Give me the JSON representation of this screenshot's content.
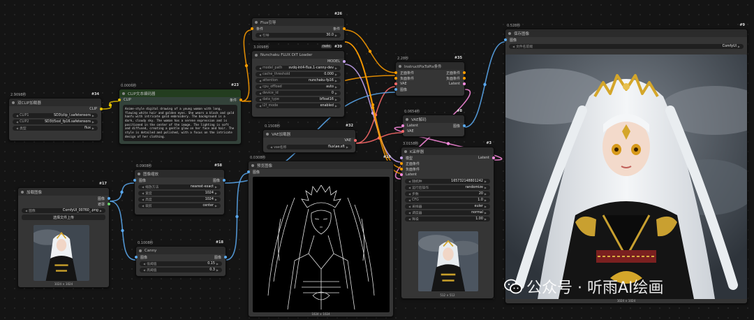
{
  "colors": {
    "clip": "#e6c200",
    "conditioning": "#ff9d00",
    "model": "#c9a7f7",
    "vae": "#ff6b6b",
    "image": "#5aa9f0",
    "latent": "#ff8ce0",
    "mask": "#6ad46a"
  },
  "nodes": {
    "dualclip": {
      "id": "#34",
      "time": "2.9098秒",
      "title": "双CLIP加载器",
      "out": "CLIP",
      "widgets": [
        {
          "label": "CLIP1",
          "value": "SD3\\clip_l.safetensors"
        },
        {
          "label": "CLIP2",
          "value": "SD3\\t5xxl_fp16.safetensors"
        },
        {
          "label": "类型",
          "value": "flux"
        }
      ]
    },
    "clipenc": {
      "id": "#23",
      "time": "0.0006秒",
      "title": "CLIP文本编码器",
      "in": "CLIP",
      "out": "条件",
      "text": "Anime-style digital drawing of a young woman with long, flowing white hair and golden eyes. She wears a black and gold hanfu with intricate gold embroidery. The background is a dark, cloudy sky. The woman has a serene expression and is positioned in the center of the image. The lighting is soft and diffused, creating a gentle glow on her face and hair. The style is detailed and polished, with a focus on the intricate design of her clothing."
    },
    "fluxguide": {
      "id": "#26",
      "title": "Flux引导",
      "in": "条件",
      "out": "条件",
      "widgets": [
        {
          "label": "引导",
          "value": "30.0"
        }
      ]
    },
    "nunchaku": {
      "id": "#39",
      "time": "3.0098秒",
      "title": "Nunchaku FLUX DiT Loader",
      "badge": "nunc",
      "out": "MODEL",
      "widgets": [
        {
          "label": "model_path",
          "value": "svdq-int4-flux.1-canny-dev"
        },
        {
          "label": "cache_threshold",
          "value": "0.000"
        },
        {
          "label": "attention",
          "value": "nunchaku-fp16"
        },
        {
          "label": "cpu_offload",
          "value": "auto"
        },
        {
          "label": "device_id",
          "value": "0"
        },
        {
          "label": "data_type",
          "value": "bfloat16"
        },
        {
          "label": "i2f_mode",
          "value": "enabled"
        }
      ]
    },
    "instruct": {
      "id": "#35",
      "time": "2.28秒",
      "title": "InstructPixToPix条件",
      "inputs": [
        "正面条件",
        "负面条件",
        "VAE",
        "图像"
      ],
      "outputs": [
        "正面条件",
        "负面条件",
        "Latent"
      ]
    },
    "vaeload": {
      "id": "#32",
      "time": "0.1508秒",
      "title": "VAE加载器",
      "out": "VAE",
      "widgets": [
        {
          "label": "vae名称",
          "value": "flux\\ae.sft"
        }
      ]
    },
    "vaedec": {
      "id": "#8",
      "time": "0.0654秒",
      "title": "VAE解码",
      "inputs": [
        "Latent",
        "VAE"
      ],
      "out": "图像"
    },
    "ksampler": {
      "id": "#3",
      "time": "3.0158秒",
      "title": "K采样器",
      "out": "Latent",
      "inputs": [
        "模型",
        "正面条件",
        "负面条件",
        "Latent"
      ],
      "widgets": [
        {
          "label": "随机种",
          "value": "165732148801242"
        },
        {
          "label": "运行后操作",
          "value": "randomize"
        },
        {
          "label": "步数",
          "value": "20"
        },
        {
          "label": "CFG",
          "value": "1.0"
        },
        {
          "label": "采样器",
          "value": "euler"
        },
        {
          "label": "调度器",
          "value": "normal"
        },
        {
          "label": "降噪",
          "value": "1.00"
        }
      ],
      "caption": "512 × 512"
    },
    "scale": {
      "id": "#58",
      "time": "0.0908秒",
      "title": "图像缩放",
      "in": "图像",
      "out": "图像",
      "widgets": [
        {
          "label": "缩放方法",
          "value": "nearest-exact"
        },
        {
          "label": "宽度",
          "value": "1024"
        },
        {
          "label": "高度",
          "value": "1024"
        },
        {
          "label": "裁剪",
          "value": "center"
        }
      ]
    },
    "loadimg": {
      "id": "#17",
      "title": "加载图像",
      "outputs": [
        "图像",
        "遮罩"
      ],
      "widgets": [
        {
          "label": "图像",
          "value": "ComfyUI_00760_.png"
        }
      ],
      "button": "选择文件上传",
      "caption": "1024 × 1024"
    },
    "canny": {
      "id": "#18",
      "time": "0.1008秒",
      "title": "Canny",
      "in": "图像",
      "out": "图像",
      "widgets": [
        {
          "label": "低阈值",
          "value": "0.15"
        },
        {
          "label": "高阈值",
          "value": "0.3"
        }
      ]
    },
    "preview": {
      "id": "#19",
      "time": "0.0308秒",
      "title": "预览图像",
      "in": "图像",
      "caption": "1024 × 1024"
    },
    "save": {
      "id": "#9",
      "time": "0.528秒",
      "title": "保存图像",
      "in": "图像",
      "widgets": [
        {
          "label": "文件名前缀",
          "value": "ComfyUI"
        }
      ],
      "caption": "1024 × 1024"
    }
  },
  "watermark": {
    "text": "公众号 · 听雨AI绘画"
  }
}
